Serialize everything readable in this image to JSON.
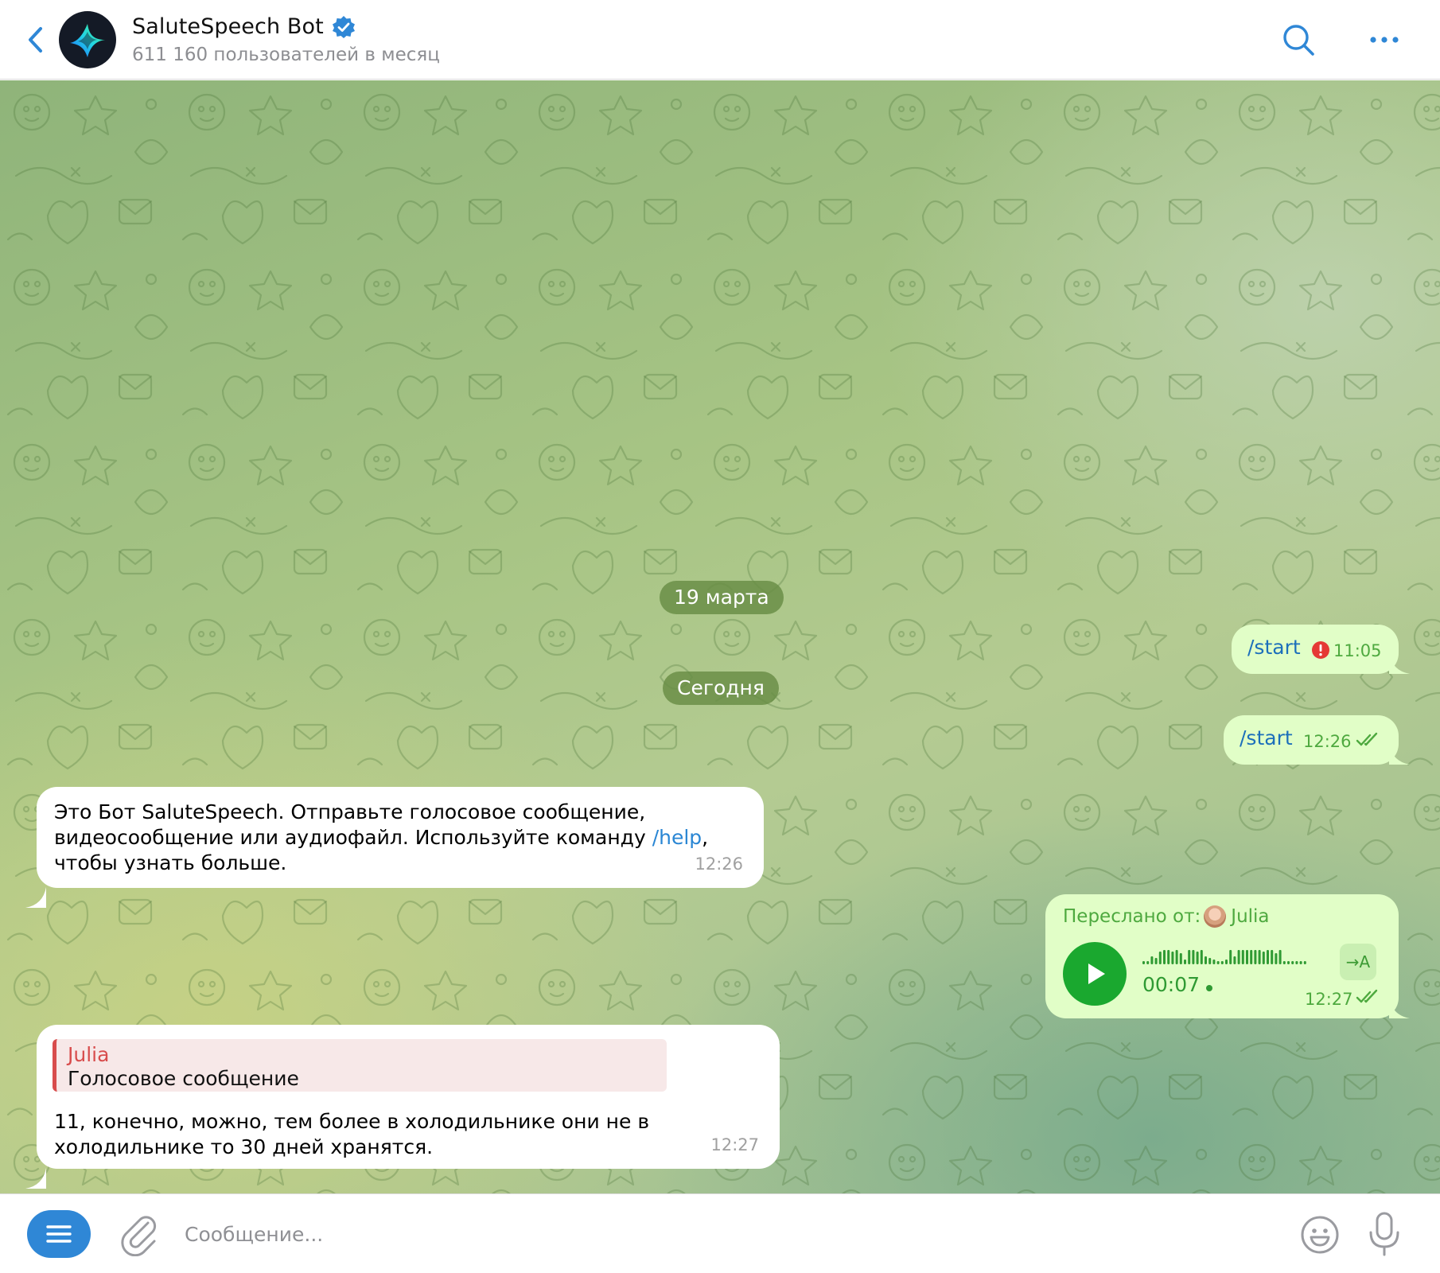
{
  "header": {
    "title": "SaluteSpeech Bot",
    "subtitle": "611 160 пользователей в месяц",
    "icons": {
      "back": "chevron-left-icon",
      "verified": "verified-badge-icon",
      "search": "search-icon",
      "more": "more-dots-icon"
    }
  },
  "chat": {
    "date_chips": [
      "19 марта",
      "Сегодня"
    ],
    "messages": [
      {
        "direction": "out",
        "text": "/start",
        "time": "11:05",
        "status": "failed"
      },
      {
        "direction": "out",
        "text": "/start",
        "time": "12:26",
        "status": "read"
      },
      {
        "direction": "in",
        "text_before": "Это Бот SaluteSpeech. Отправьте голосовое сообщение, видеосообщение или аудиофайл. Используйте команду ",
        "link": "/help",
        "text_after": ", чтобы узнать больше.",
        "time": "12:26"
      },
      {
        "direction": "out",
        "type": "voice",
        "forwarded_label": "Переслано от:",
        "forwarded_from": "Julia",
        "duration": "00:07",
        "transcribe_label": "→A",
        "time": "12:27",
        "status": "read"
      },
      {
        "direction": "in",
        "reply_name": "Julia",
        "reply_text": "Голосовое сообщение",
        "text": "11, конечно, можно, тем более в холодильнике они не в холодильнике то 30 дней хранятся.",
        "time": "12:27"
      }
    ]
  },
  "composer": {
    "placeholder": "Сообщение...",
    "icons": {
      "menu": "menu-icon",
      "attach": "paperclip-icon",
      "emoji": "emoji-icon",
      "mic": "microphone-icon"
    }
  },
  "colors": {
    "accent": "#2f87d6",
    "outgoing_bubble": "#e1fec7",
    "incoming_bubble": "#ffffff",
    "play_button": "#1aa82f",
    "error": "#e53935",
    "reply_accent": "#d84c4c"
  }
}
